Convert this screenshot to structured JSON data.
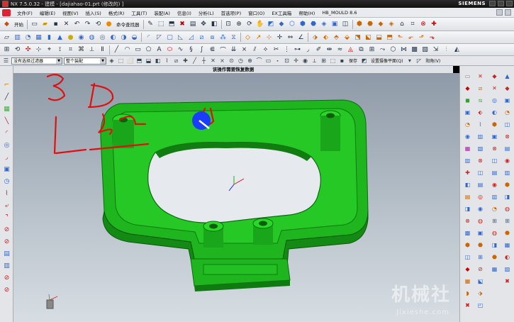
{
  "window": {
    "title": "NX 7.5.0.32 - 建模 - [dajiahao-01.prt  (修改的)  ]",
    "brand": "SIEMENS"
  },
  "menu": [
    "文件(F)",
    "编辑(E)",
    "视图(V)",
    "插入(S)",
    "格式(R)",
    "工具(T)",
    "装配(A)",
    "信息(I)",
    "分析(L)",
    "首选项(P)",
    "窗口(O)",
    "EX工具箱",
    "帮助(H)",
    "HB_MOULD 8.6"
  ],
  "toolbar1": {
    "start_label": "开始",
    "command_finder_label": "命令查找器"
  },
  "filterbar": {
    "select_filter": "没有选择过滤器",
    "scope": "整个装配",
    "save_label": "保存",
    "snap_label": "设置摄像平面(Q)",
    "angle_label": "阳角(V)"
  },
  "prompt": "该操作需要恢复数据",
  "annotations": [
    "3",
    "D",
    "Zr",
    "U"
  ],
  "watermark": {
    "main": "机械社",
    "sub": "Jixieshe.com"
  },
  "colors": {
    "model_green": "#1fb51f",
    "annotation_red": "#e01010",
    "cursor_blue": "#1a3cff"
  }
}
